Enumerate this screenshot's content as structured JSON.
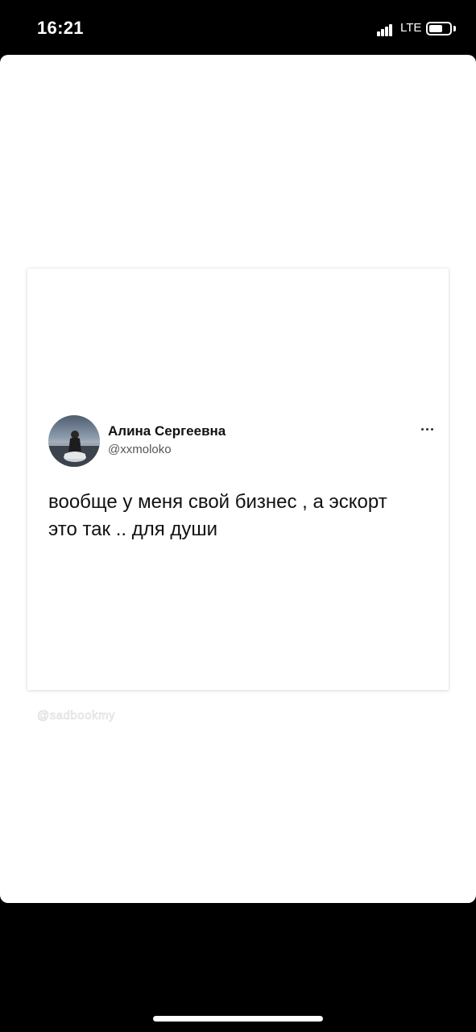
{
  "status_bar": {
    "time": "16:21",
    "network": "LTE",
    "icons": [
      "signal-icon",
      "battery-icon"
    ]
  },
  "post": {
    "author_name": "Алина Сергеевна",
    "author_handle": "@xxmoloko",
    "text_lines": [
      "вообще у меня свой бизнес , а эскорт",
      "это так .. для души"
    ],
    "more_icon": "more-horizontal-icon",
    "avatar": "avatar-image"
  },
  "watermark": "@sadbookmy",
  "colors": {
    "background": "#000000",
    "sheet": "#ffffff",
    "text": "#111111",
    "handle": "#555555"
  }
}
